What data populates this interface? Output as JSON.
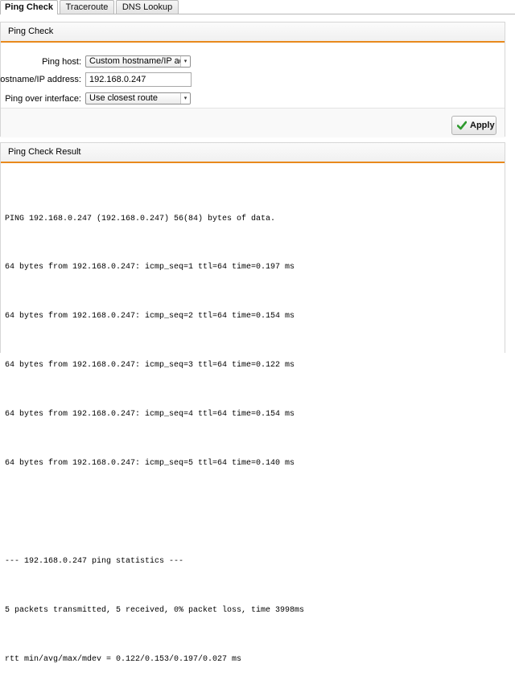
{
  "tabs": [
    {
      "label": "Ping Check",
      "active": true
    },
    {
      "label": "Traceroute",
      "active": false
    },
    {
      "label": "DNS Lookup",
      "active": false
    }
  ],
  "ping_panel": {
    "title": "Ping Check",
    "host_label": "Ping host:",
    "host_value": "Custom hostname/IP adc",
    "hostname_label": "Hostname/IP address:",
    "hostname_value": "192.168.0.247",
    "interface_label": "Ping over interface:",
    "interface_value": "Use closest route",
    "apply_label": "Apply"
  },
  "result_panel": {
    "title": "Ping Check Result",
    "lines": [
      "PING 192.168.0.247 (192.168.0.247) 56(84) bytes of data.",
      "64 bytes from 192.168.0.247: icmp_seq=1 ttl=64 time=0.197 ms",
      "64 bytes from 192.168.0.247: icmp_seq=2 ttl=64 time=0.154 ms",
      "64 bytes from 192.168.0.247: icmp_seq=3 ttl=64 time=0.122 ms",
      "64 bytes from 192.168.0.247: icmp_seq=4 ttl=64 time=0.154 ms",
      "64 bytes from 192.168.0.247: icmp_seq=5 ttl=64 time=0.140 ms",
      "",
      "--- 192.168.0.247 ping statistics ---",
      "5 packets transmitted, 5 received, 0% packet loss, time 3998ms",
      "rtt min/avg/max/mdev = 0.122/0.153/0.197/0.027 ms"
    ]
  },
  "colors": {
    "accent": "#e8891c",
    "check": "#2e9a2e"
  }
}
